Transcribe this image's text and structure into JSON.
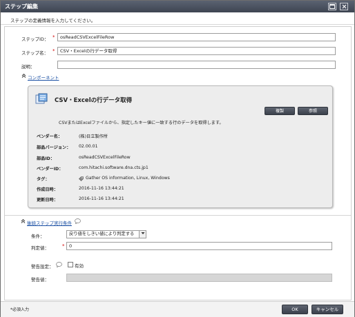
{
  "window": {
    "title": "ステップ編集",
    "subtitle": "ステップの定義情報を入力してください。"
  },
  "form": {
    "step_id_label": "ステップID：",
    "step_id_value": "osReadCSVExcelFileRow",
    "step_name_label": "ステップ名：",
    "step_name_value": "CSV・Excelの行データ取得",
    "description_label": "説明：",
    "description_value": "",
    "required_mark": "*"
  },
  "component": {
    "section_label": "コンポーネント",
    "title": "CSV・Excelの行データ取得",
    "copy_button": "複製",
    "browse_button": "参照",
    "description": "CSVまたはExcelファイルから、指定したキー値に一致する行のデータを取得します。",
    "properties": [
      {
        "key": "ベンダー名：",
        "value": "(株)日立製作所"
      },
      {
        "key": "部品バージョン：",
        "value": "02.00.01"
      },
      {
        "key": "部品ID：",
        "value": "osReadCSVExcelFileRow"
      },
      {
        "key": "ベンダーID：",
        "value": "com.hitachi.software.dna.cts.jp1"
      },
      {
        "key": "タグ：",
        "value": "Gather OS information, Linux, Windows"
      },
      {
        "key": "作成日時：",
        "value": "2016-11-16 13:44:21"
      },
      {
        "key": "更新日時：",
        "value": "2016-11-16 13:44:21"
      }
    ]
  },
  "condition": {
    "section_label": "後続ステップ実行条件",
    "condition_label": "条件：",
    "condition_value": "戻り値をしきい値により判定する",
    "judge_label": "判定値：",
    "judge_value": "0",
    "warning_setting_label": "警告設定：",
    "enable_label": "有効",
    "warning_value_label": "警告値："
  },
  "footer": {
    "required_note": "*必須入力",
    "ok_button": "OK",
    "cancel_button": "キャンセル"
  }
}
